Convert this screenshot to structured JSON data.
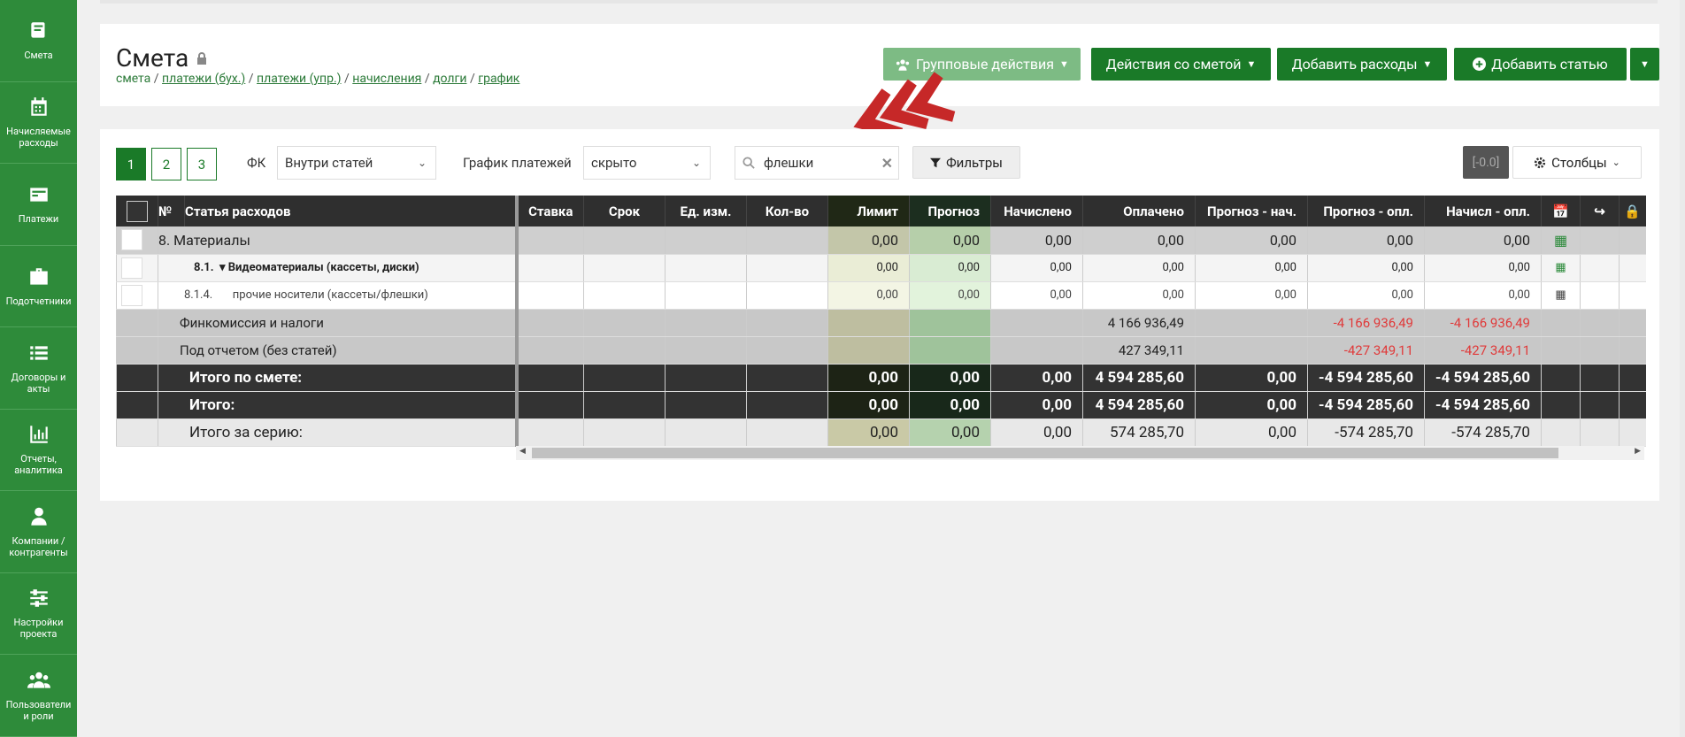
{
  "sidebar": {
    "items": [
      {
        "label": "Смета",
        "icon": "book-icon"
      },
      {
        "label": "Начисляемые расходы",
        "icon": "calendar-icon"
      },
      {
        "label": "Платежи",
        "icon": "payments-icon"
      },
      {
        "label": "Подотчетники",
        "icon": "briefcase-icon"
      },
      {
        "label": "Договоры и акты",
        "icon": "list-icon"
      },
      {
        "label": "Отчеты, аналитика",
        "icon": "bar-chart-icon"
      },
      {
        "label": "Компании / контрагенты",
        "icon": "person-icon"
      },
      {
        "label": "Настройки проекта",
        "icon": "sliders-icon"
      },
      {
        "label": "Пользователи и роли",
        "icon": "users-icon"
      }
    ]
  },
  "header": {
    "title": "Смета",
    "breadcrumb": {
      "current": "смета",
      "links": [
        "платежи (бух.)",
        "платежи (упр.)",
        "начисления",
        "долги",
        "график"
      ],
      "sep": " / "
    },
    "buttons": {
      "group_actions": "Групповые действия",
      "estimate_actions": "Действия со сметой",
      "add_expenses": "Добавить расходы",
      "add_item": "Добавить статью"
    }
  },
  "toolbar": {
    "pages": [
      "1",
      "2",
      "3"
    ],
    "fk_label": "ФК",
    "fk_value": "Внутри статей",
    "schedule_label": "График платежей",
    "schedule_value": "скрыто",
    "search_value": "флешки",
    "filters_label": "Фильтры",
    "zero_badge": "[-0.0]",
    "columns_label": "Столбцы"
  },
  "table": {
    "headers": [
      "№",
      "Статья расходов",
      "Ставка",
      "Срок",
      "Ед. изм.",
      "Кол-во",
      "Лимит",
      "Прогноз",
      "Начислено",
      "Оплачено",
      "Прогноз - нач.",
      "Прогноз - опл.",
      "Начисл - опл."
    ],
    "rows": [
      {
        "num": "",
        "name": "8. Материалы",
        "limit": "0,00",
        "forecast": "0,00",
        "accrued": "0,00",
        "paid": "0,00",
        "fc_acc": "0,00",
        "fc_paid": "0,00",
        "acc_paid": "0,00"
      },
      {
        "num": "8.1.",
        "name": "Видеоматериалы (кассеты, диски)",
        "limit": "0,00",
        "forecast": "0,00",
        "accrued": "0,00",
        "paid": "0,00",
        "fc_acc": "0,00",
        "fc_paid": "0,00",
        "acc_paid": "0,00"
      },
      {
        "num": "8.1.4.",
        "name": "прочие носители (кассеты/флешки)",
        "limit": "0,00",
        "forecast": "0,00",
        "accrued": "0,00",
        "paid": "0,00",
        "fc_acc": "0,00",
        "fc_paid": "0,00",
        "acc_paid": "0,00"
      },
      {
        "name": "Финкомиссия и налоги",
        "paid": "4 166 936,49",
        "fc_paid": "-4 166 936,49",
        "acc_paid": "-4 166 936,49"
      },
      {
        "name": "Под отчетом (без статей)",
        "paid": "427 349,11",
        "fc_paid": "-427 349,11",
        "acc_paid": "-427 349,11"
      },
      {
        "name": "Итого по смете:",
        "limit": "0,00",
        "forecast": "0,00",
        "accrued": "0,00",
        "paid": "4 594 285,60",
        "fc_acc": "0,00",
        "fc_paid": "-4 594 285,60",
        "acc_paid": "-4 594 285,60"
      },
      {
        "name": "Итого:",
        "limit": "0,00",
        "forecast": "0,00",
        "accrued": "0,00",
        "paid": "4 594 285,60",
        "fc_acc": "0,00",
        "fc_paid": "-4 594 285,60",
        "acc_paid": "-4 594 285,60"
      },
      {
        "name": "Итого за серию:",
        "limit": "0,00",
        "forecast": "0,00",
        "accrued": "0,00",
        "paid": "574 285,70",
        "fc_acc": "0,00",
        "fc_paid": "-574 285,70",
        "acc_paid": "-574 285,70"
      }
    ]
  },
  "colors": {
    "sidebar": "#2e8b3a",
    "primary": "#1a7a28",
    "negative": "#e03a3a"
  }
}
